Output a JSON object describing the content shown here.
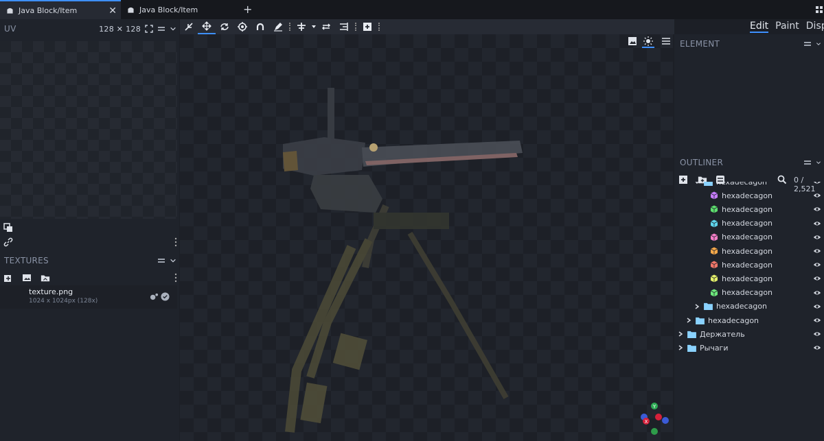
{
  "tabs": [
    {
      "label": "Java Block/Item",
      "close": "✕"
    },
    {
      "label": "Java Block/Item"
    }
  ],
  "new_tab": "+",
  "uv": {
    "title": "UV",
    "size": "128 ✕ 128"
  },
  "textures": {
    "title": "TEXTURES",
    "items": [
      {
        "name": "texture.png",
        "meta": "1024 x 1024px (128x)"
      }
    ]
  },
  "modes": [
    "Edit",
    "Paint",
    "Display"
  ],
  "element": {
    "title": "ELEMENT"
  },
  "outliner": {
    "title": "OUTLINER",
    "count": "0 / 2,521",
    "rows": [
      {
        "label": "hexadecagon",
        "type": "folder",
        "depth": 2,
        "open": true
      },
      {
        "label": "hexadecagon",
        "type": "cube",
        "depth": 3,
        "color": "#c77dff"
      },
      {
        "label": "hexadecagon",
        "type": "cube",
        "depth": 3,
        "color": "#5ee06e"
      },
      {
        "label": "hexadecagon",
        "type": "cube",
        "depth": 3,
        "color": "#5fd6ee"
      },
      {
        "label": "hexadecagon",
        "type": "cube",
        "depth": 3,
        "color": "#f57ec8"
      },
      {
        "label": "hexadecagon",
        "type": "cube",
        "depth": 3,
        "color": "#f7a94a"
      },
      {
        "label": "hexadecagon",
        "type": "cube",
        "depth": 3,
        "color": "#f2776a"
      },
      {
        "label": "hexadecagon",
        "type": "cube",
        "depth": 3,
        "color": "#e4f06a"
      },
      {
        "label": "hexadecagon",
        "type": "cube",
        "depth": 3,
        "color": "#6de87c"
      },
      {
        "label": "hexadecagon",
        "type": "folder",
        "depth": 2,
        "open": false
      },
      {
        "label": "hexadecagon",
        "type": "folder",
        "depth": 1,
        "open": false
      },
      {
        "label": "Держатель",
        "type": "folder",
        "depth": 0,
        "open": false
      },
      {
        "label": "Рычаги",
        "type": "folder",
        "depth": 0,
        "open": false
      }
    ]
  },
  "gizmo": {
    "x_label": "X",
    "y_label": "Y"
  },
  "colors": {
    "accent": "#3e90ff",
    "folder": "#8ad2ff"
  }
}
